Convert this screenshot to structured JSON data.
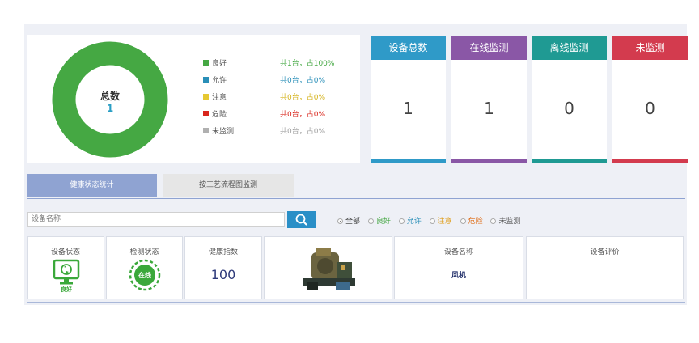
{
  "summary": {
    "title": "总数",
    "total": "1",
    "legend": [
      {
        "label": "良好",
        "stat": "共1台，占100%",
        "color": "#45a843",
        "stat_color": "#45a843"
      },
      {
        "label": "允许",
        "stat": "共0台，占0%",
        "color": "#2a8fb8",
        "stat_color": "#2a8fb8"
      },
      {
        "label": "注意",
        "stat": "共0台，占0%",
        "color": "#e6c832",
        "stat_color": "#d4b21a"
      },
      {
        "label": "危险",
        "stat": "共0台，占0%",
        "color": "#d9261c",
        "stat_color": "#d9261c"
      },
      {
        "label": "未监测",
        "stat": "共0台，占0%",
        "color": "#b0b0b0",
        "stat_color": "#a0a0a0"
      }
    ],
    "donut": {
      "good_fraction": 1.0,
      "color": "#45a843"
    }
  },
  "stats": [
    {
      "label": "设备总数",
      "value": "1",
      "color": "#2f9ac8"
    },
    {
      "label": "在线监测",
      "value": "1",
      "color": "#8a57a6"
    },
    {
      "label": "离线监测",
      "value": "0",
      "color": "#1f9a93"
    },
    {
      "label": "未监测",
      "value": "0",
      "color": "#d33b4e"
    }
  ],
  "tabs": {
    "health": "健康状态统计",
    "process": "按工艺流程图监测"
  },
  "search": {
    "placeholder": "设备名称"
  },
  "filters": [
    {
      "label": "全部",
      "checked": true,
      "color": "#333333"
    },
    {
      "label": "良好",
      "checked": false,
      "color": "#45a843"
    },
    {
      "label": "允许",
      "checked": false,
      "color": "#2a8fb8"
    },
    {
      "label": "注意",
      "checked": false,
      "color": "#e0a020"
    },
    {
      "label": "危险",
      "checked": false,
      "color": "#e0701c"
    },
    {
      "label": "未监测",
      "checked": false,
      "color": "#555555"
    }
  ],
  "device": {
    "status_label": "设备状态",
    "status_value": "良好",
    "detect_label": "检测状态",
    "detect_value": "在线",
    "health_label": "健康指数",
    "health_value": "100",
    "name_label": "设备名称",
    "name_value": "风机",
    "rating_label": "设备评价",
    "icon_color": "#3aa83a"
  }
}
